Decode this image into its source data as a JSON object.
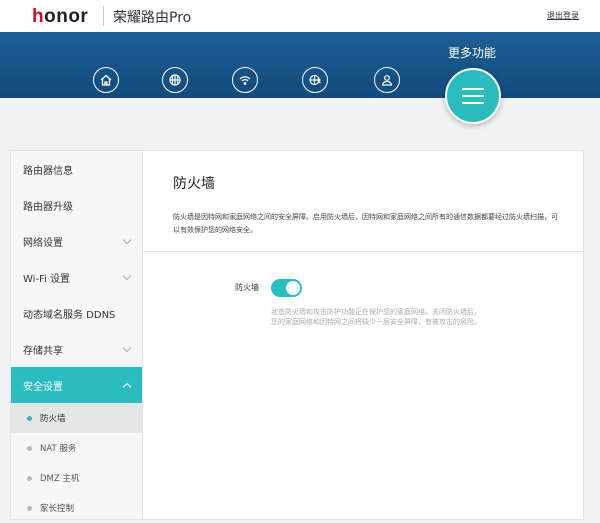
{
  "header": {
    "logo": "honor",
    "product": "荣耀路由Pro",
    "logout": "退出登录"
  },
  "nav": {
    "items": [
      "home-icon",
      "globe-icon",
      "wifi-icon",
      "internet-icon",
      "user-icon"
    ],
    "more_label": "更多功能"
  },
  "sidebar": {
    "items": [
      {
        "label": "路由器信息"
      },
      {
        "label": "路由器升级"
      },
      {
        "label": "网络设置"
      },
      {
        "label": "Wi-Fi 设置"
      },
      {
        "label": "动态域名服务 DDNS"
      },
      {
        "label": "存储共享"
      },
      {
        "label": "安全设置"
      }
    ],
    "subitems": [
      {
        "label": "防火墙"
      },
      {
        "label": "NAT 服务"
      },
      {
        "label": "DMZ 主机"
      },
      {
        "label": "家长控制"
      }
    ]
  },
  "main": {
    "title": "防火墙",
    "description": "防火墙是因特网和家庭网络之间的安全屏障。启用防火墙后，因特网和家庭网络之间所有的通信数据都要经过防火墙扫描，可以有效保护您的网络安全。",
    "firewall_label": "防火墙",
    "firewall_enabled": true,
    "hint": "状态防火墙和攻击防护功能正在保护您的家庭网络。关闭防火墙后，您的家庭网络和因特网之间将缺少一层安全屏障，有被攻击的风险。"
  },
  "colors": {
    "accent": "#2bbcc0",
    "band": "#1a5a8f"
  }
}
